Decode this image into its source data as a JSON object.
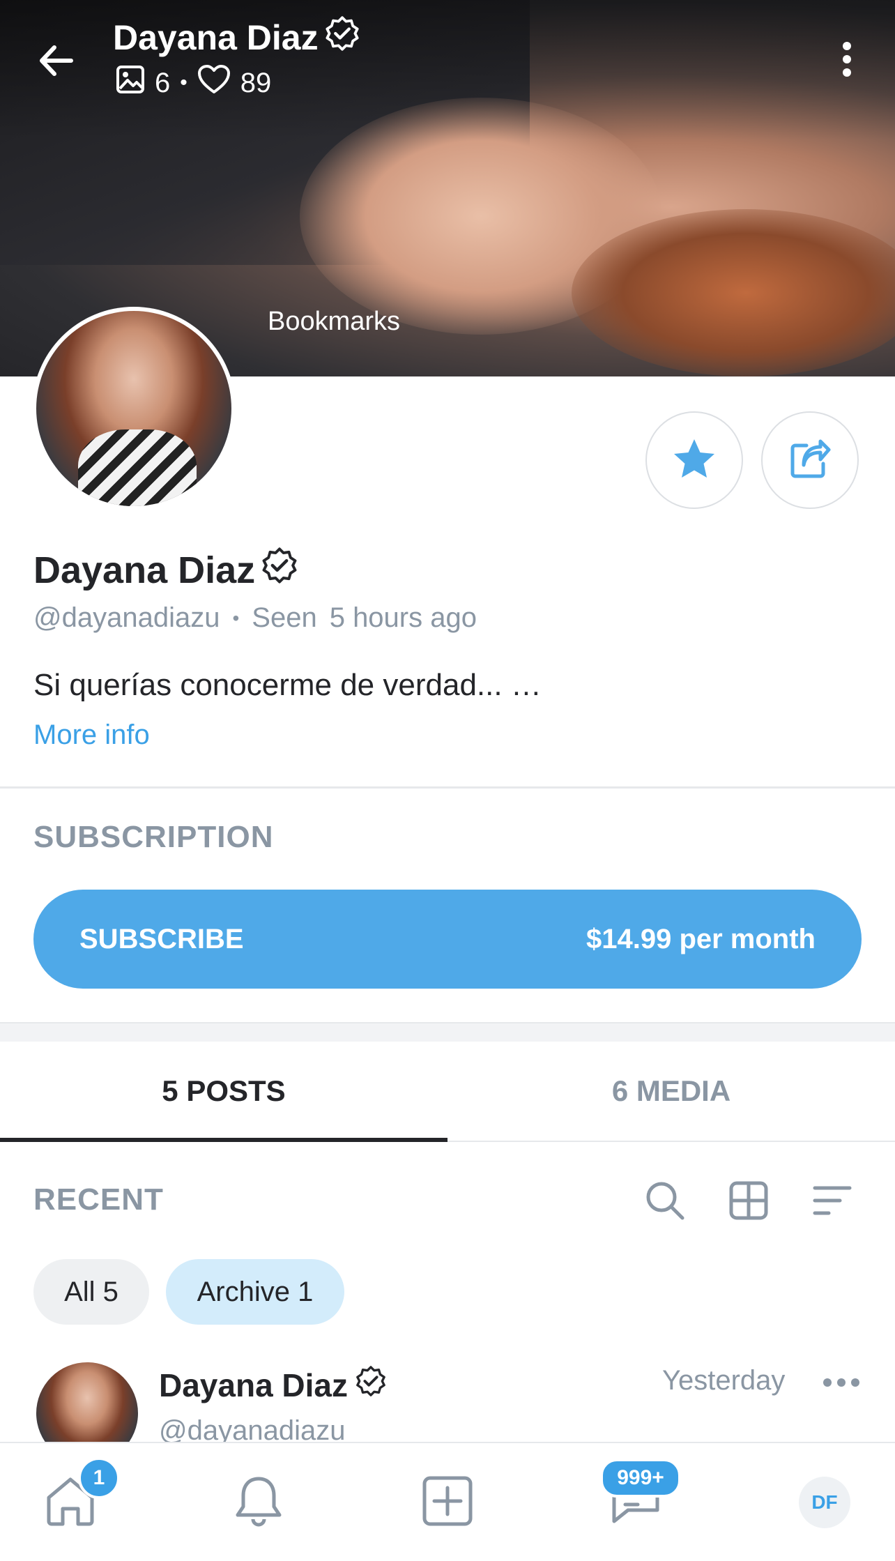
{
  "header": {
    "title": "Dayana Diaz",
    "photos_count": "6",
    "likes_count": "89",
    "cover_label": "Bookmarks",
    "icons": [
      "back-arrow-icon",
      "verified-icon",
      "image-icon",
      "heart-icon",
      "more-vertical-icon"
    ]
  },
  "profile": {
    "name": "Dayana Diaz",
    "handle": "@dayanadiazu",
    "seen_label": "Seen",
    "seen_time": "5 hours ago",
    "bio": "Si querías conocerme de verdad... …",
    "more_info": "More info",
    "actions": [
      "star-icon",
      "share-icon"
    ]
  },
  "subscription": {
    "title": "SUBSCRIPTION",
    "button_label": "SUBSCRIBE",
    "price": "$14.99 per month"
  },
  "tabs": [
    {
      "label": "5 POSTS",
      "active": true
    },
    {
      "label": "6 MEDIA",
      "active": false
    }
  ],
  "recent": {
    "title": "RECENT",
    "tools": [
      "search-icon",
      "grid-icon",
      "sort-icon"
    ],
    "filters": [
      {
        "label": "All 5",
        "active": false
      },
      {
        "label": "Archive 1",
        "active": true
      }
    ]
  },
  "post": {
    "name": "Dayana Diaz",
    "handle": "@dayanadiazu",
    "time": "Yesterday"
  },
  "bottom_nav": {
    "home_badge": "1",
    "messages_badge": "999+",
    "profile_initials": "DF",
    "icons": [
      "home-icon",
      "bell-icon",
      "add-post-icon",
      "messages-icon"
    ]
  },
  "colors": {
    "accent": "#4fa9e8",
    "link": "#3aa0e6",
    "muted": "#8a96a3",
    "chip_active": "#d3ecfb",
    "chip_inactive": "#eef0f2"
  }
}
